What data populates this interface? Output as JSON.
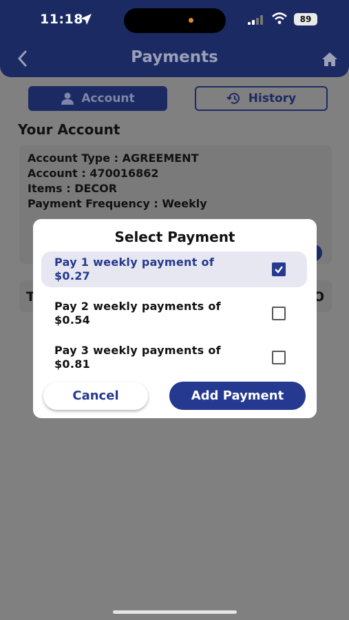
{
  "status": {
    "time": "11:18",
    "battery": "89",
    "icons": [
      "location-arrow-icon",
      "signal-icon",
      "wifi-icon",
      "battery-icon"
    ]
  },
  "header": {
    "title": "Payments",
    "back_icon": "chevron-left-icon",
    "home_icon": "home-icon"
  },
  "tabs": [
    {
      "label": "Account",
      "icon": "person-icon",
      "active": true
    },
    {
      "label": "History",
      "icon": "history-icon",
      "active": false
    }
  ],
  "account": {
    "section_title": "Your Account",
    "lines": [
      "Account Type : AGREEMENT",
      "Account : 470016862",
      "Items : DECOR",
      "Payment Frequency : Weekly"
    ],
    "second_card_left": "T",
    "second_card_right": "O"
  },
  "modal": {
    "title": "Select Payment",
    "options": [
      {
        "label": "Pay 1 weekly payment of $0.27",
        "checked": true
      },
      {
        "label": "Pay 2 weekly payments of $0.54",
        "checked": false
      },
      {
        "label": "Pay 3 weekly payments of $0.81",
        "checked": false
      }
    ],
    "cancel_label": "Cancel",
    "add_label": "Add Payment"
  },
  "colors": {
    "brand_navy": "#1c2a63",
    "accent_blue": "#24398f",
    "overlay": "#808080",
    "selected_bg": "#e6e7f1"
  }
}
